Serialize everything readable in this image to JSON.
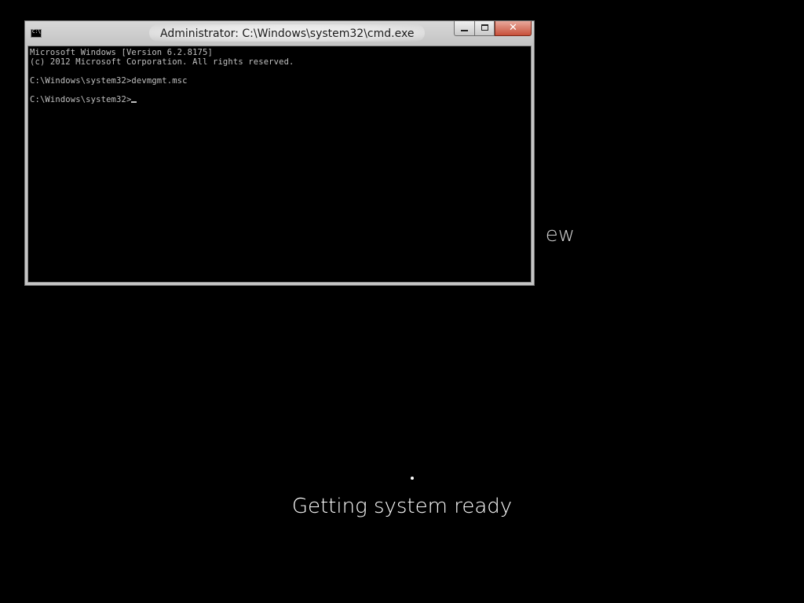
{
  "background": {
    "heading_fragment": "ew",
    "status_text": "Getting system ready"
  },
  "window": {
    "title": "Administrator: C:\\Windows\\system32\\cmd.exe",
    "icon_label": "C:\\",
    "icon": "cmd-icon"
  },
  "console": {
    "lines": [
      "Microsoft Windows [Version 6.2.8175]",
      "(c) 2012 Microsoft Corporation. All rights reserved.",
      "",
      "C:\\Windows\\system32>devmgmt.msc",
      "",
      "C:\\Windows\\system32>"
    ]
  },
  "controls": {
    "minimize": "minimize-icon",
    "maximize": "maximize-icon",
    "close": "close-icon",
    "close_glyph": "✕"
  }
}
